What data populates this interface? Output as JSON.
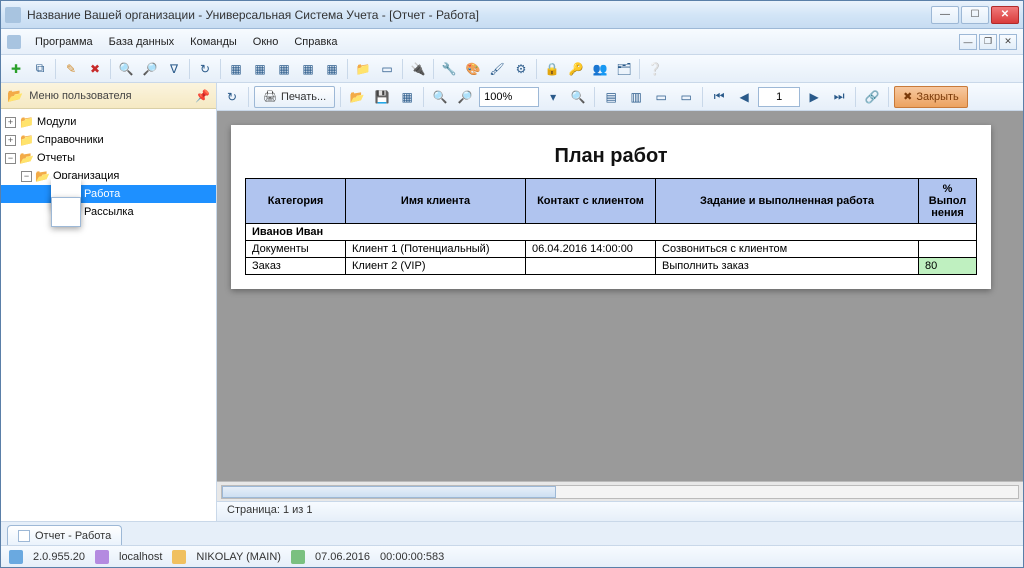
{
  "window": {
    "title": "Название Вашей организации - Универсальная Система Учета - [Отчет - Работа]"
  },
  "menu": {
    "items": [
      "Программа",
      "База данных",
      "Команды",
      "Окно",
      "Справка"
    ]
  },
  "sidebar": {
    "header": "Меню пользователя",
    "nodes": {
      "modules": "Модули",
      "refs": "Справочники",
      "reports": "Отчеты",
      "org": "Организация",
      "work": "Работа",
      "mailing": "Рассылка"
    }
  },
  "report_toolbar": {
    "print": "Печать...",
    "zoom": "100%",
    "page": "1",
    "close": "Закрыть"
  },
  "report": {
    "title": "План работ",
    "headers": {
      "category": "Категория",
      "client_name": "Имя клиента",
      "contact": "Контакт с клиентом",
      "task": "Задание и выполненная работа",
      "pct": "% Выпол нения"
    },
    "group_name": "Иванов Иван",
    "rows": [
      {
        "category": "Документы",
        "client": "Клиент 1 (Потенциальный)",
        "contact": "06.04.2016 14:00:00",
        "task": "Созвониться с клиентом",
        "pct": ""
      },
      {
        "category": "Заказ",
        "client": "Клиент 2 (VIP)",
        "contact": "",
        "task": "Выполнить заказ",
        "pct": "80"
      }
    ]
  },
  "page_status": "Страница: 1 из 1",
  "doc_tab": "Отчет - Работа",
  "status": {
    "version": "2.0.955.20",
    "host": "localhost",
    "user": "NIKOLAY (MAIN)",
    "date": "07.06.2016",
    "time": "00:00:00:583"
  }
}
